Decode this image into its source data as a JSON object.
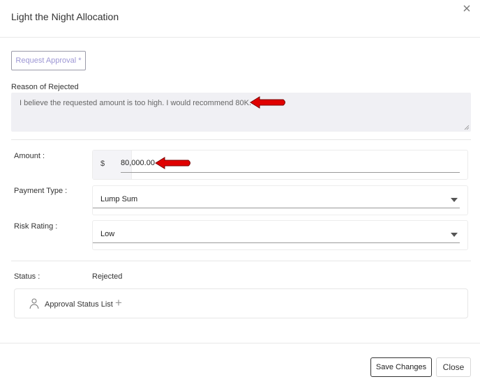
{
  "dialog": {
    "title": "Light the Night Allocation",
    "close_icon": "close-icon"
  },
  "request_approval": {
    "label": "Request Approval *"
  },
  "reason": {
    "label": "Reason of Rejected",
    "value": "I believe the requested amount is too high. I would recommend 80K."
  },
  "amount": {
    "label": "Amount :",
    "prefix": "$",
    "value": "80,000.00"
  },
  "payment_type": {
    "label": "Payment Type :",
    "value": "Lump Sum"
  },
  "risk_rating": {
    "label": "Risk Rating :",
    "value": "Low"
  },
  "status": {
    "label": "Status :",
    "value": "Rejected"
  },
  "approval_list": {
    "label": "Approval Status List",
    "icon": "person-icon",
    "add_icon": "plus-icon"
  },
  "footer": {
    "save_label": "Save Changes",
    "close_label": "Close"
  },
  "colors": {
    "annotation_arrow": "#e00000",
    "request_text": "#9c96d4",
    "reason_background": "#f0f0f4"
  }
}
